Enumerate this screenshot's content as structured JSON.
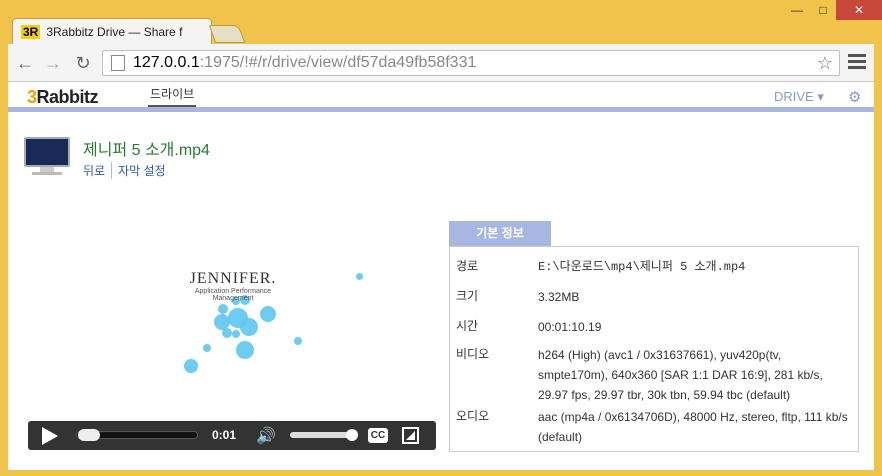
{
  "browser": {
    "tab_title": "3Rabbitz Drive — Share f",
    "tab_logo": "3R",
    "url_host": "127.0.0.1",
    "url_rest": ":1975/!#/r/drive/view/df57da49fb58f331"
  },
  "app": {
    "brand_prefix": "3",
    "brand_name": "Rabbitz",
    "nav_drive": "드라이브",
    "drive_menu": "DRIVE ▾"
  },
  "file": {
    "title": "제니퍼 5 소개.mp4",
    "link_back": "뒤로",
    "link_subtitle": "자막 설정"
  },
  "video": {
    "logo_name": "JENNIFER.",
    "logo_sub": "Application Performance Management",
    "time": "0:01",
    "cc_label": "CC",
    "progress": 0.02,
    "volume": 0.9
  },
  "info": {
    "tab_label": "기본 정보",
    "rows": [
      {
        "label": "경로",
        "value": "E:\\다운로드\\mp4\\제니퍼 5 소개.mp4"
      },
      {
        "label": "크기",
        "value": "3.32MB"
      },
      {
        "label": "시간",
        "value": "00:01:10.19"
      },
      {
        "label": "비디오",
        "value": "h264 (High) (avc1 / 0x31637661), yuv420p(tv, smpte170m), 640x360 [SAR 1:1 DAR 16:9], 281 kb/s, 29.97 fps, 29.97 tbr, 30k tbn, 59.94 tbc (default)"
      },
      {
        "label": "오디오",
        "value": "aac (mp4a / 0x6134706D), 48000 Hz, stereo, fltp, 111 kb/s (default)"
      }
    ]
  }
}
